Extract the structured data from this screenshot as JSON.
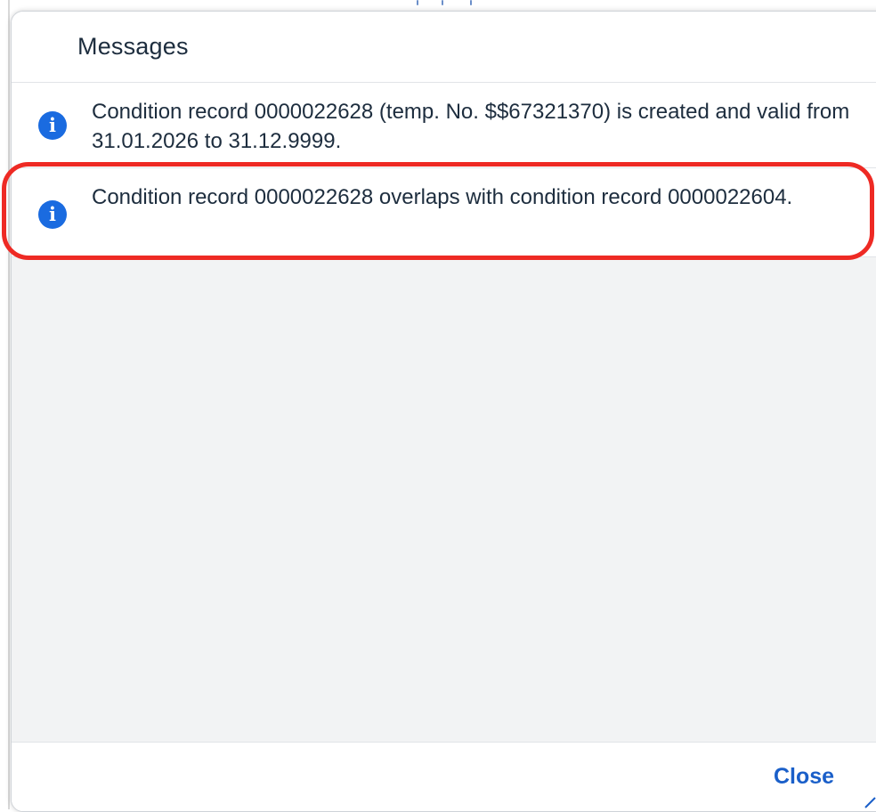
{
  "dialog": {
    "title": "Messages"
  },
  "messages": [
    {
      "type": "info",
      "icon": "info-icon",
      "text": "Condition record 0000022628 (temp. No. $$67321370) is created and valid from 31.01.2026 to 31.12.9999."
    },
    {
      "type": "info",
      "icon": "info-icon",
      "text": "Condition record 0000022628 overlaps with condition record 0000022604."
    }
  ],
  "footer": {
    "close_label": "Close"
  },
  "colors": {
    "info_icon": "#1a6be0",
    "highlight": "#ee2a24",
    "link": "#1a5fc9",
    "list_background": "#f2f3f4"
  }
}
